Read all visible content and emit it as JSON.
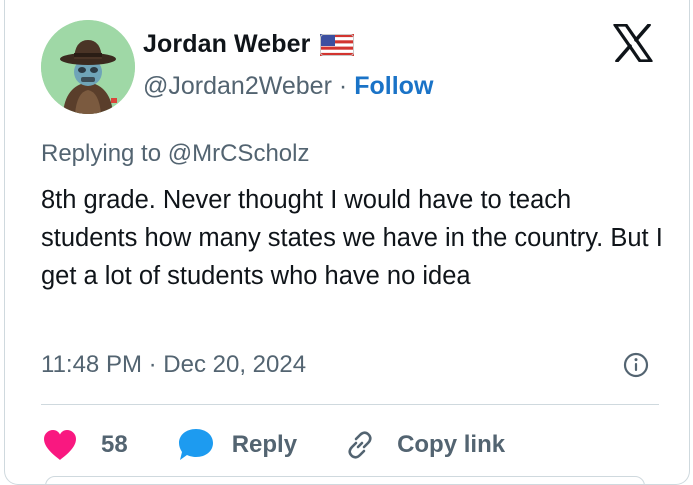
{
  "author": {
    "name": "Jordan Weber",
    "handle": "@Jordan2Weber",
    "separator": "·",
    "follow_label": "Follow",
    "flag_icon": "us-flag-icon"
  },
  "reply_context": {
    "prefix": "Replying to",
    "mention": "@MrCScholz"
  },
  "tweet": {
    "text": "8th grade. Never thought I would have to teach students how many states we have in the country. But I get a lot of students who have no idea",
    "time": "11:48 PM",
    "time_separator": "·",
    "date": "Dec 20, 2024"
  },
  "actions": {
    "like_count": "58",
    "reply_label": "Reply",
    "copy_link_label": "Copy link"
  },
  "colors": {
    "text_primary": "#0f1419",
    "text_secondary": "#536471",
    "link_blue": "#1a73c7",
    "heart_pink": "#f91880",
    "reply_blue": "#1d9bf0",
    "border": "#cfd9de"
  },
  "icons": [
    "avatar",
    "us-flag-icon",
    "x-logo-icon",
    "info-icon",
    "heart-icon",
    "reply-bubble-icon",
    "link-icon"
  ]
}
